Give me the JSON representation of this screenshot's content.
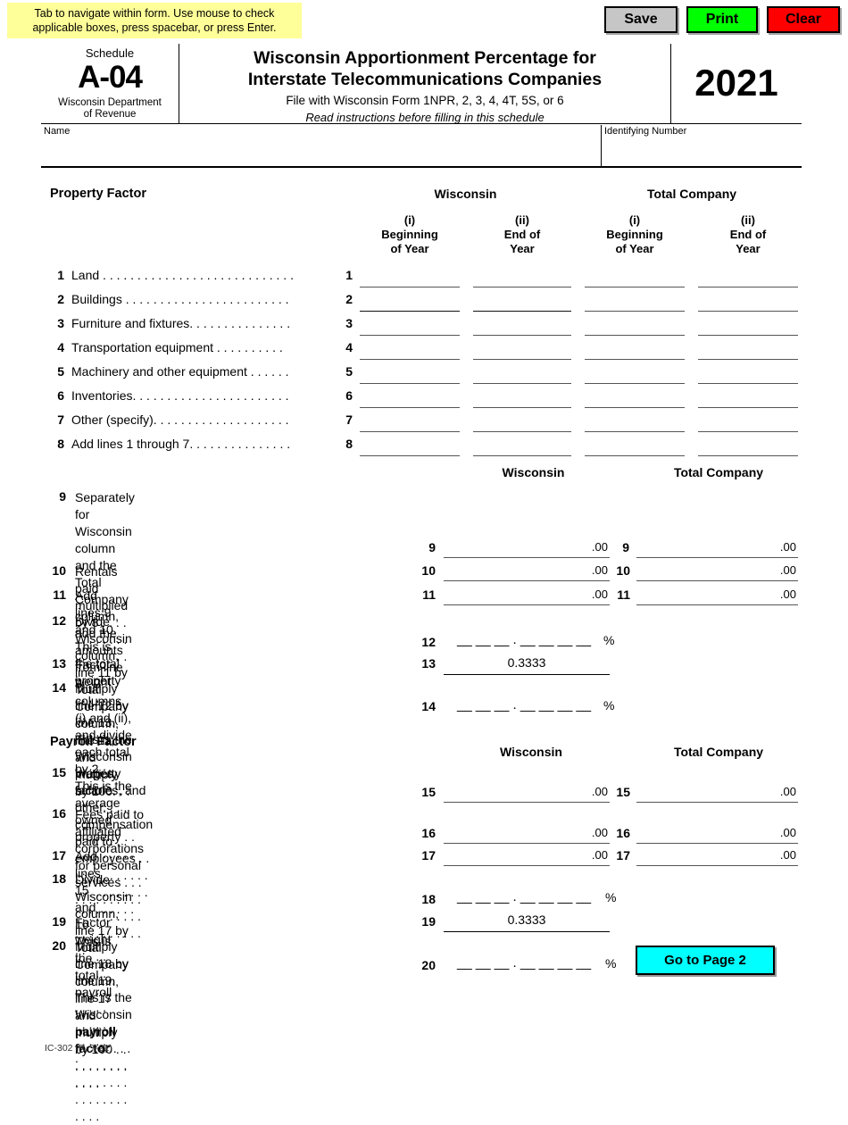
{
  "toolbar": {
    "tip": "Tab to navigate within form. Use mouse to check applicable boxes, press spacebar, or press Enter.",
    "save_label": "Save",
    "print_label": "Print",
    "clear_label": "Clear",
    "colors": {
      "save": "#c6c6c6",
      "print": "#00ff00",
      "clear": "#ff0000",
      "tip_bg": "#ffff99"
    }
  },
  "header": {
    "schedule_label": "Schedule",
    "schedule_code": "A-04",
    "department_line1": "Wisconsin Department",
    "department_line2": "of Revenue",
    "title_line1": "Wisconsin Apportionment Percentage for",
    "title_line2": "Interstate Telecommunications Companies",
    "subtitle": "File with Wisconsin Form 1NPR, 2, 3, 4, 4T, 5S, or 6",
    "instruction": "Read instructions before filling in this schedule",
    "year": "2021"
  },
  "identity": {
    "name_label": "Name",
    "name_value": "",
    "id_label": "Identifying Number",
    "id_value": ""
  },
  "property_factor": {
    "section_title": "Property Factor",
    "group_headers": {
      "wisconsin": "Wisconsin",
      "total_company": "Total Company"
    },
    "sub_headers": [
      {
        "roman": "(i)",
        "line1": "Beginning",
        "line2": "of Year"
      },
      {
        "roman": "(ii)",
        "line1": "End of",
        "line2": "Year"
      },
      {
        "roman": "(i)",
        "line1": "Beginning",
        "line2": "of Year"
      },
      {
        "roman": "(ii)",
        "line1": "End of",
        "line2": "Year"
      }
    ],
    "rows": [
      {
        "num": "1",
        "desc": "Land . . . . . . . . . . . . . . . . . . . . . . . . . . . .",
        "num2": "1"
      },
      {
        "num": "2",
        "desc": "Buildings . . . . . . . . . . . . . . . . . . . . . . . .",
        "num2": "2"
      },
      {
        "num": "3",
        "desc": "Furniture and fixtures. . . . . . . . . . . . . . .",
        "num2": "3"
      },
      {
        "num": "4",
        "desc": "Transportation equipment . . . . . . . . . .",
        "num2": "4"
      },
      {
        "num": "5",
        "desc": "Machinery and other equipment  . . . . . .",
        "num2": "5"
      },
      {
        "num": "6",
        "desc": "Inventories. . . . . . . . . . . . . . . . . . . . . . .",
        "num2": "6"
      },
      {
        "num": "7",
        "desc": "Other (specify). . . . . . . . . . . . . . . . . . . .",
        "num2": "7"
      },
      {
        "num": "8",
        "desc": "Add lines 1 through 7. . . . . . . . . . . . . . .",
        "num2": "8"
      }
    ],
    "values": {
      "r1": [
        "",
        "",
        "",
        ""
      ],
      "r2": [
        "",
        "",
        "",
        ""
      ],
      "r3": [
        "",
        "",
        "",
        ""
      ],
      "r4": [
        "",
        "",
        "",
        ""
      ],
      "r5": [
        "",
        "",
        "",
        ""
      ],
      "r6": [
        "",
        "",
        "",
        ""
      ],
      "r7": [
        "",
        "",
        "",
        ""
      ],
      "r8": [
        "",
        "",
        "",
        ""
      ]
    }
  },
  "property_summary": {
    "col_wisconsin": "Wisconsin",
    "col_total_company": "Total Company",
    "line9": {
      "num": "9",
      "desc_l1": "Separately for Wisconsin column and the Total",
      "desc_l2": "Company column, add the amounts from line 8,",
      "desc_l3": "columns (i) and (ii), and divide each total by 2.",
      "desc_l4": "This is the average owned property . . . . . . . . . . . . . . .",
      "lbl_wi": "9",
      "lbl_tc": "9",
      "val_wi": "",
      "val_tc": "",
      "cents": ".00"
    },
    "line10": {
      "num": "10",
      "desc_l1": "Rentals paid multiplied by 8 . . . . . . . . . . . . . . . . . . . . .",
      "lbl_wi": "10",
      "lbl_tc": "10",
      "val_wi": "",
      "val_tc": "",
      "cents": ".00"
    },
    "line11": {
      "num": "11",
      "desc_l1": "Add lines 9 and 10. This is the total property . . . . . . . .",
      "lbl_wi": "11",
      "lbl_tc": "11",
      "val_wi": "",
      "val_tc": "",
      "cents": ".00"
    },
    "line12": {
      "num": "12",
      "desc_l1": "Divide Wisconsin column, line 11 by Total Company",
      "desc_l2": "column, line 11, and multiply by 100. . . . . . . . . . . . . . .",
      "lbl_wi": "12",
      "placeholder": "__ __ __ . __ __ __ __",
      "percent": "%"
    },
    "line13": {
      "num": "13",
      "desc_l1": "Factor weight . . . . . . . . . . . . . . . . . . . . . . . . . . . . . . .",
      "lbl_wi": "13",
      "weight_value": "0.3333"
    },
    "line14": {
      "num": "14",
      "desc_l1": "Multiply line 12 by line 13. This is the Wisconsin",
      "desc_l2": "property factor. . . . . . . . . . . . . . . . . . . . . . . . . . . . . . .",
      "lbl_wi": "14",
      "placeholder": "__ __ __ . __ __ __ __",
      "percent": "%"
    }
  },
  "payroll_factor": {
    "section_title": "Payroll Factor",
    "col_wisconsin": "Wisconsin",
    "col_total_company": "Total Company",
    "line15": {
      "num": "15",
      "desc_l1": "Wages, salaries, and other compensation paid to",
      "desc_l2": "employees . . . . . . . . . . . . . . . . . . . . . . . . . . . . . . . . .",
      "lbl_wi": "15",
      "lbl_tc": "15",
      "val_wi": "",
      "val_tc": "",
      "cents": ".00"
    },
    "line16": {
      "num": "16",
      "desc_l1": "Fees paid to affiliated corporations for personal",
      "desc_l2": "services . . . . . . . . . . . . . . . . . . . . . . . . . . . . . . . . . . .",
      "lbl_wi": "16",
      "lbl_tc": "16",
      "val_wi": "",
      "val_tc": "",
      "cents": ".00"
    },
    "line17": {
      "num": "17",
      "desc_l1": "Add lines 15 and 16. This is the total payroll . . . . . . . .",
      "lbl_wi": "17",
      "lbl_tc": "17",
      "val_wi": "",
      "val_tc": "",
      "cents": ".00"
    },
    "line18": {
      "num": "18",
      "desc_l1": "Divide Wisconsin column, line 17 by Total Company",
      "desc_l2": "column, line 17 and multiply by 100 . . . . . . . . . . . . . .",
      "lbl_wi": "18",
      "placeholder": "__ __ __ . __ __ __ __",
      "percent": "%"
    },
    "line19": {
      "num": "19",
      "desc_l1": "Factor weight . . . . . . . . . . . . . . . . . . . . . . . . . . . . . . .",
      "lbl_wi": "19",
      "weight_value": "0.3333"
    },
    "line20": {
      "num": "20",
      "desc_l1": "Multiply line 18 by line 19. This is the Wisconsin",
      "desc_l2_bold": "payroll factor",
      "desc_l2_rest": " . . . . . . . . . . . . . . . . . . . . . . . . . . . . . . .",
      "lbl_wi": "20",
      "placeholder": "__ __ __ . __ __ __ __",
      "percent": "%"
    },
    "goto_button": {
      "label": "Go to Page 2",
      "color": "#00ffff"
    }
  },
  "footer": {
    "form_id": "IC-302 (R. 7-21)"
  }
}
